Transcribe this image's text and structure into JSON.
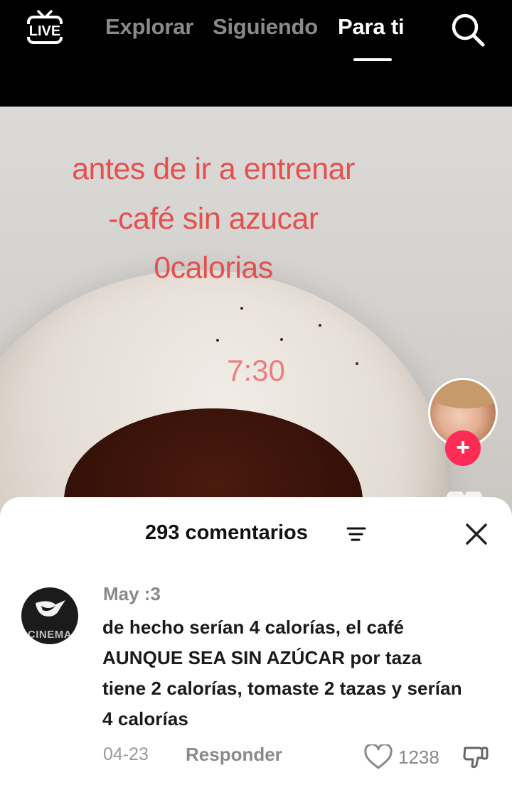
{
  "nav": {
    "live_label": "LIVE",
    "tabs": [
      {
        "label": "Explorar",
        "active": false
      },
      {
        "label": "Siguiendo",
        "active": false
      },
      {
        "label": "Para ti",
        "active": true
      }
    ],
    "search_icon": "search-icon"
  },
  "video": {
    "overlay_lines": [
      "antes de ir a entrenar",
      "-café sin azucar",
      "0calorias"
    ],
    "timestamp": "7:30",
    "follow_icon": "plus"
  },
  "comments": {
    "title": "293 comentarios",
    "sort_icon": "sort-icon",
    "close_icon": "close-icon",
    "items": [
      {
        "avatar_text": "CINEMA",
        "username": "May :3",
        "text": "de hecho serían 4 calorías, el café AUNQUE SEA SIN AZÚCAR por taza tiene 2 calorías, tomaste 2 tazas y serían 4 calorías",
        "date": "04-23",
        "reply_label": "Responder",
        "likes": "1238"
      }
    ]
  },
  "colors": {
    "accent": "#fe2c55",
    "overlay_text": "#e4504e",
    "muted": "#8a8a8a"
  }
}
